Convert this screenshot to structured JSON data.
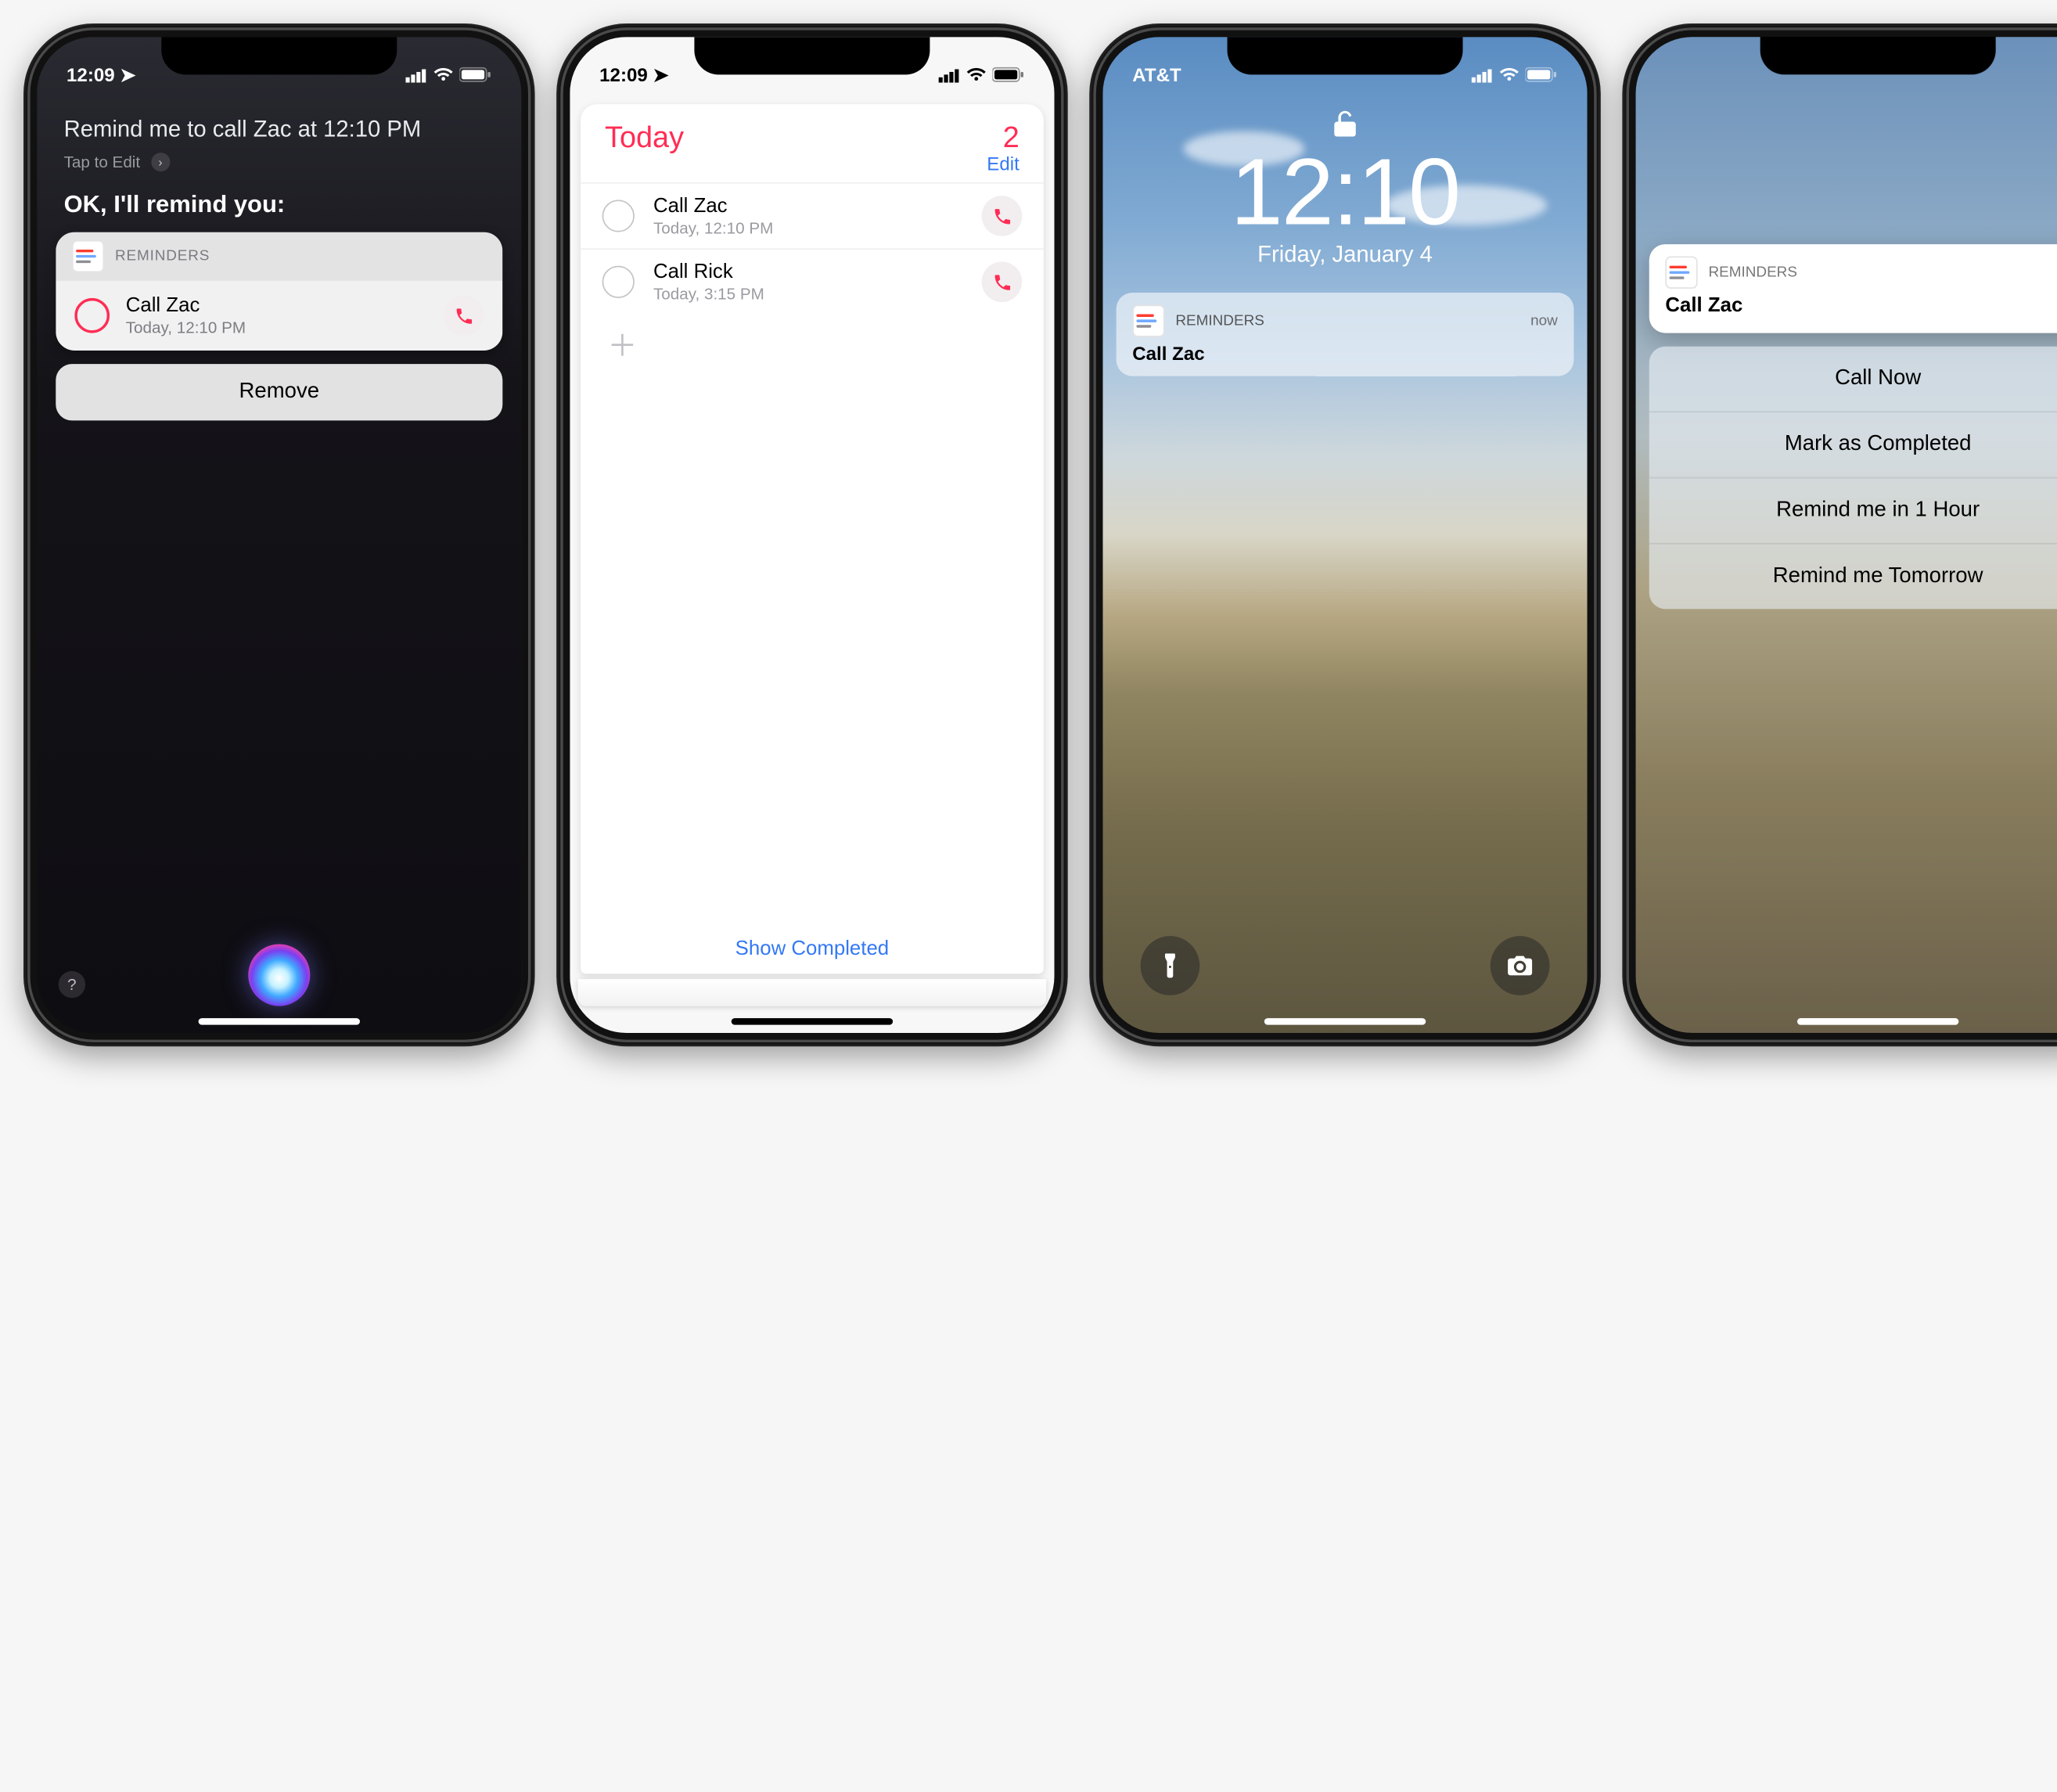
{
  "phone1": {
    "status_time": "12:09",
    "query": "Remind me to call Zac at 12:10 PM",
    "tap_edit": "Tap to Edit",
    "reply": "OK, I'll remind you:",
    "app_label": "REMINDERS",
    "reminder_title": "Call Zac",
    "reminder_sub": "Today, 12:10 PM",
    "remove": "Remove",
    "help": "?"
  },
  "phone2": {
    "status_time": "12:09",
    "header": "Today",
    "count": "2",
    "edit": "Edit",
    "items": [
      {
        "title": "Call Zac",
        "sub": "Today, 12:10 PM"
      },
      {
        "title": "Call Rick",
        "sub": "Today, 3:15 PM"
      }
    ],
    "show_completed": "Show Completed"
  },
  "phone3": {
    "carrier": "AT&T",
    "time": "12:10",
    "date": "Friday, January 4",
    "app_label": "REMINDERS",
    "when": "now",
    "body": "Call Zac"
  },
  "phone4": {
    "app_label": "REMINDERS",
    "body": "Call Zac",
    "actions": [
      "Call Now",
      "Mark as Completed",
      "Remind me in 1 Hour",
      "Remind me Tomorrow"
    ]
  }
}
